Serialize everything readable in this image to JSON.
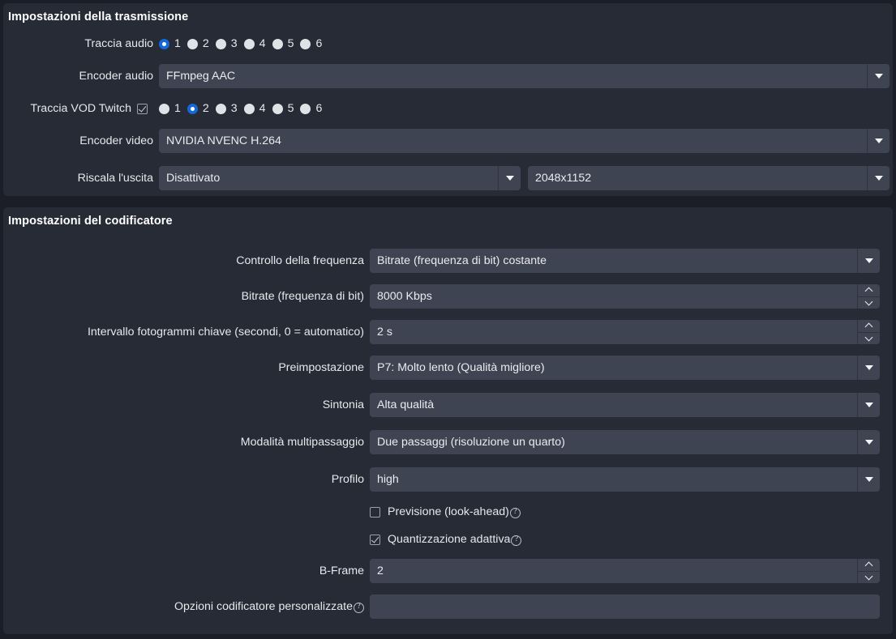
{
  "stream_settings": {
    "title": "Impostazioni della trasmissione",
    "audio_track": {
      "label": "Traccia audio",
      "options": [
        "1",
        "2",
        "3",
        "4",
        "5",
        "6"
      ],
      "selected": "1"
    },
    "audio_encoder": {
      "label": "Encoder audio",
      "value": "FFmpeg AAC"
    },
    "vod_track": {
      "label": "Traccia VOD Twitch",
      "enabled": true,
      "options": [
        "1",
        "2",
        "3",
        "4",
        "5",
        "6"
      ],
      "selected": "2"
    },
    "video_encoder": {
      "label": "Encoder video",
      "value": "NVIDIA NVENC H.264"
    },
    "rescale_output": {
      "label": "Riscala l'uscita",
      "value": "Disattivato",
      "resolution": "2048x1152"
    }
  },
  "encoder_settings": {
    "title": "Impostazioni del codificatore",
    "rate_control": {
      "label": "Controllo della frequenza",
      "value": "Bitrate (frequenza di bit) costante"
    },
    "bitrate": {
      "label": "Bitrate (frequenza di bit)",
      "value": "8000 Kbps"
    },
    "keyframe_interval": {
      "label": "Intervallo fotogrammi chiave (secondi, 0 = automatico)",
      "value": "2 s"
    },
    "preset": {
      "label": "Preimpostazione",
      "value": "P7: Molto lento (Qualità migliore)"
    },
    "tuning": {
      "label": "Sintonia",
      "value": "Alta qualità"
    },
    "multipass_mode": {
      "label": "Modalità multipassaggio",
      "value": "Due passaggi (risoluzione un quarto)"
    },
    "profile": {
      "label": "Profilo",
      "value": "high"
    },
    "lookahead": {
      "label": "Previsione (look-ahead)",
      "checked": false,
      "help": "?"
    },
    "adaptive_quantization": {
      "label": "Quantizzazione adattiva",
      "checked": true,
      "help": "?"
    },
    "bframe": {
      "label": "B-Frame",
      "value": "2"
    },
    "custom_encoder_options": {
      "label": "Opzioni codificatore personalizzate",
      "value": "",
      "placeholder": "",
      "help": "?"
    }
  },
  "colors": {
    "page_bg": "#1b1e27",
    "panel_bg": "#262b36",
    "field_bg": "#3e4451",
    "accent": "#1569d6",
    "text": "#e6e8ec"
  }
}
